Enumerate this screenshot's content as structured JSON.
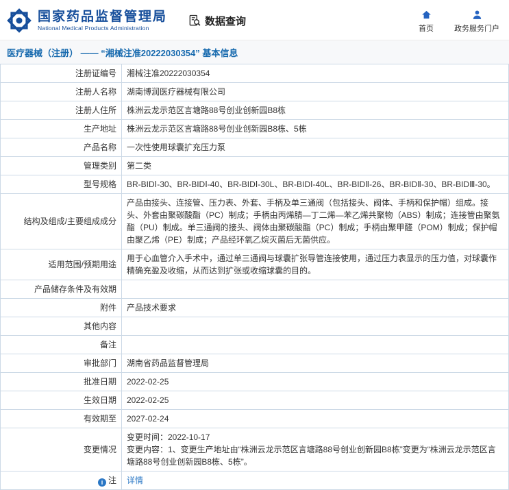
{
  "header": {
    "logo_cn": "国家药品监督管理局",
    "logo_en": "National Medical Products Administration",
    "data_query": "数据查询",
    "nav": [
      {
        "label": "首页"
      },
      {
        "label": "政务服务门户"
      }
    ]
  },
  "title_bar": {
    "title": "医疗器械（注册） —— “湘械注准20222030354” 基本信息"
  },
  "table": {
    "rows": [
      {
        "label": "注册证编号",
        "value": "湘械注准20222030354"
      },
      {
        "label": "注册人名称",
        "value": "湖南博润医疗器械有限公司"
      },
      {
        "label": "注册人住所",
        "value": "株洲云龙示范区言塘路88号创业创新园B8栋"
      },
      {
        "label": "生产地址",
        "value": "株洲云龙示范区言塘路88号创业创新园B8栋、5栋"
      },
      {
        "label": "产品名称",
        "value": "一次性使用球囊扩充压力泵"
      },
      {
        "label": "管理类别",
        "value": "第二类"
      },
      {
        "label": "型号规格",
        "value": "BR-BIDⅠ-30、BR-BIDⅠ-40、BR-BIDⅠ-30L、BR-BIDⅠ-40L、BR-BIDⅡ-26、BR-BIDⅡ-30、BR-BIDⅢ-30。"
      },
      {
        "label": "结构及组成/主要组成成分",
        "value": "产品由接头、连接管、压力表、外套、手柄及单三通阀（包括接头、阀体、手柄和保护帽）组成。接头、外套由聚碳酸酯（PC）制成；手柄由丙烯腈—丁二烯—苯乙烯共聚物（ABS）制成；连接管由聚氨酯（PU）制成。单三通阀的接头、阀体由聚碳酸酯（PC）制成；手柄由聚甲醛（POM）制成；保护帽由聚乙烯（PE）制成；产品经环氧乙烷灭菌后无菌供应。"
      },
      {
        "label": "适用范围/预期用途",
        "value": "用于心血管介入手术中，通过单三通阀与球囊扩张导管连接使用，通过压力表显示的压力值，对球囊作精确充盈及收缩，从而达到扩张或收缩球囊的目的。"
      },
      {
        "label": "产品储存条件及有效期",
        "value": ""
      },
      {
        "label": "附件",
        "value": "产品技术要求"
      },
      {
        "label": "其他内容",
        "value": ""
      },
      {
        "label": "备注",
        "value": ""
      },
      {
        "label": "审批部门",
        "value": "湖南省药品监督管理局"
      },
      {
        "label": "批准日期",
        "value": "2022-02-25"
      },
      {
        "label": "生效日期",
        "value": "2022-02-25"
      },
      {
        "label": "有效期至",
        "value": "2027-02-24"
      },
      {
        "label": "变更情况",
        "value": "变更时间：2022-10-17\n变更内容：1、变更生产地址由“株洲云龙示范区言塘路88号创业创新园B8栋”变更为“株洲云龙示范区言塘路88号创业创新园B8栋、5栋”。"
      },
      {
        "label": "注",
        "value": "详情"
      }
    ]
  },
  "colors": {
    "brand_blue": "#164e9b",
    "title_blue": "#1669ae",
    "link_blue": "#2a77c5",
    "border_blue": "#ccd9e6"
  }
}
